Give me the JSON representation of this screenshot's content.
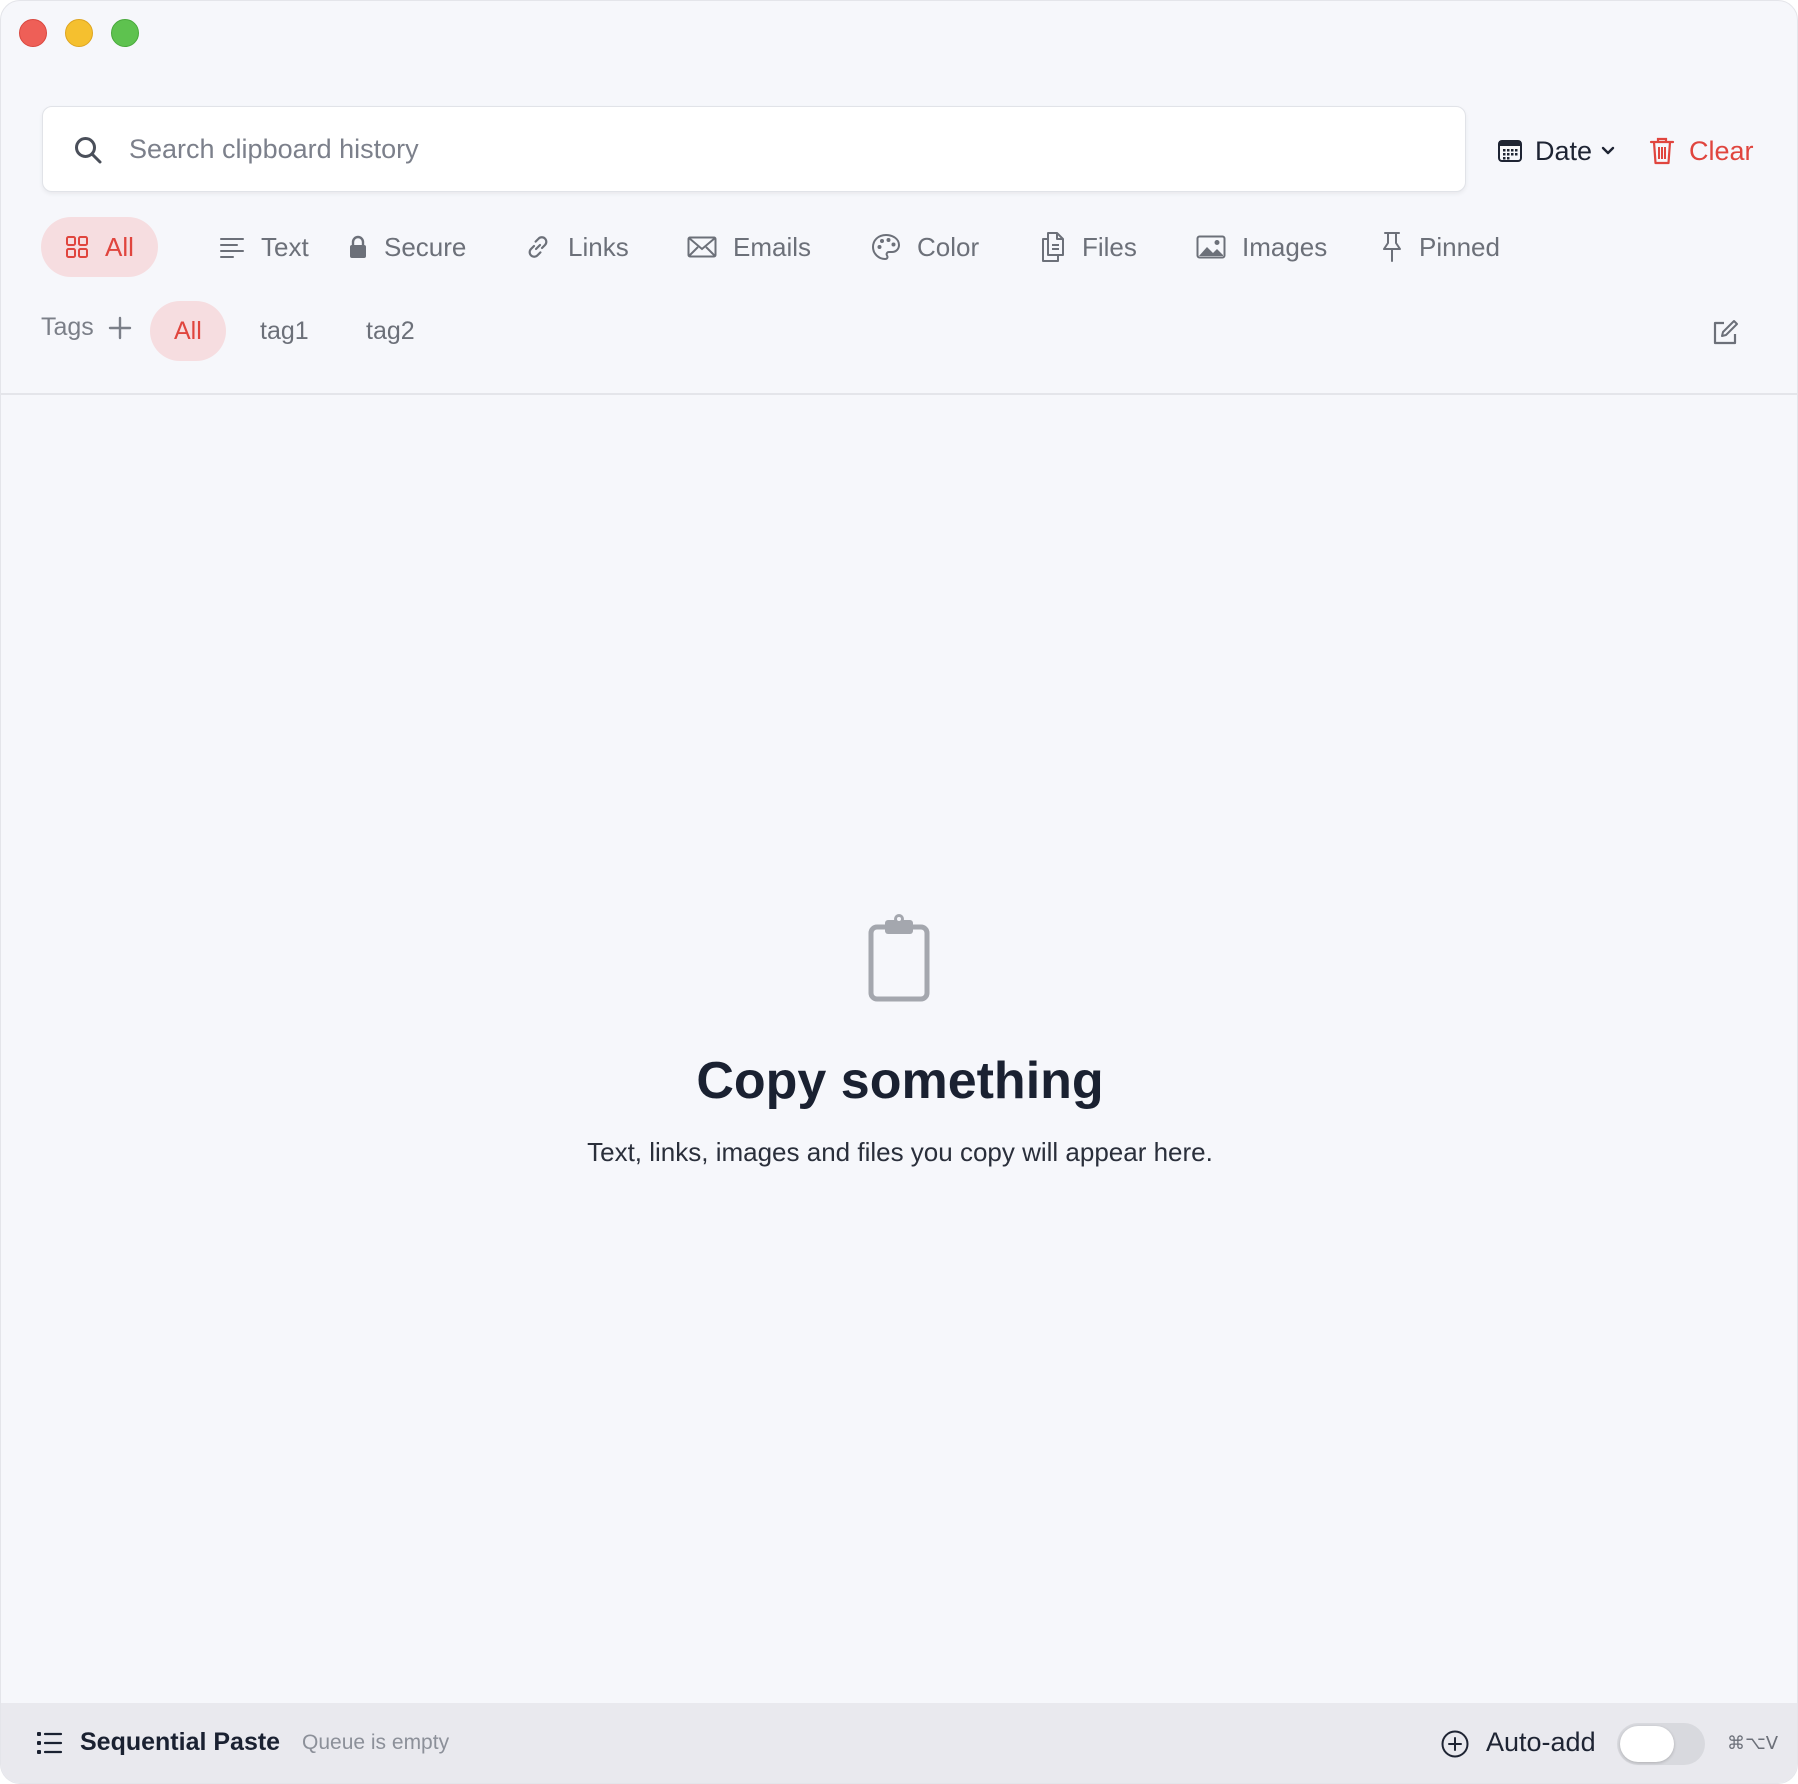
{
  "search": {
    "placeholder": "Search clipboard history"
  },
  "toolbar": {
    "sort_label": "Date",
    "clear_label": "Clear",
    "accent_color": "#e0453e"
  },
  "categories": [
    {
      "label": "All",
      "icon": "grid-icon",
      "active": true
    },
    {
      "label": "Text",
      "icon": "text-lines-icon"
    },
    {
      "label": "Secure",
      "icon": "lock-icon"
    },
    {
      "label": "Links",
      "icon": "link-icon"
    },
    {
      "label": "Emails",
      "icon": "envelope-icon"
    },
    {
      "label": "Color",
      "icon": "palette-icon"
    },
    {
      "label": "Files",
      "icon": "files-icon"
    },
    {
      "label": "Images",
      "icon": "image-icon"
    },
    {
      "label": "Pinned",
      "icon": "pin-icon"
    }
  ],
  "tags": {
    "label": "Tags",
    "items": [
      {
        "label": "All",
        "active": true
      },
      {
        "label": "tag1"
      },
      {
        "label": "tag2"
      }
    ]
  },
  "empty_state": {
    "title": "Copy something",
    "subtitle": "Text, links, images and files you copy will appear here."
  },
  "footer": {
    "title": "Sequential Paste",
    "queue_status": "Queue is empty",
    "auto_add_label": "Auto-add",
    "auto_add_enabled": false,
    "shortcut": "⌘⌥V"
  }
}
